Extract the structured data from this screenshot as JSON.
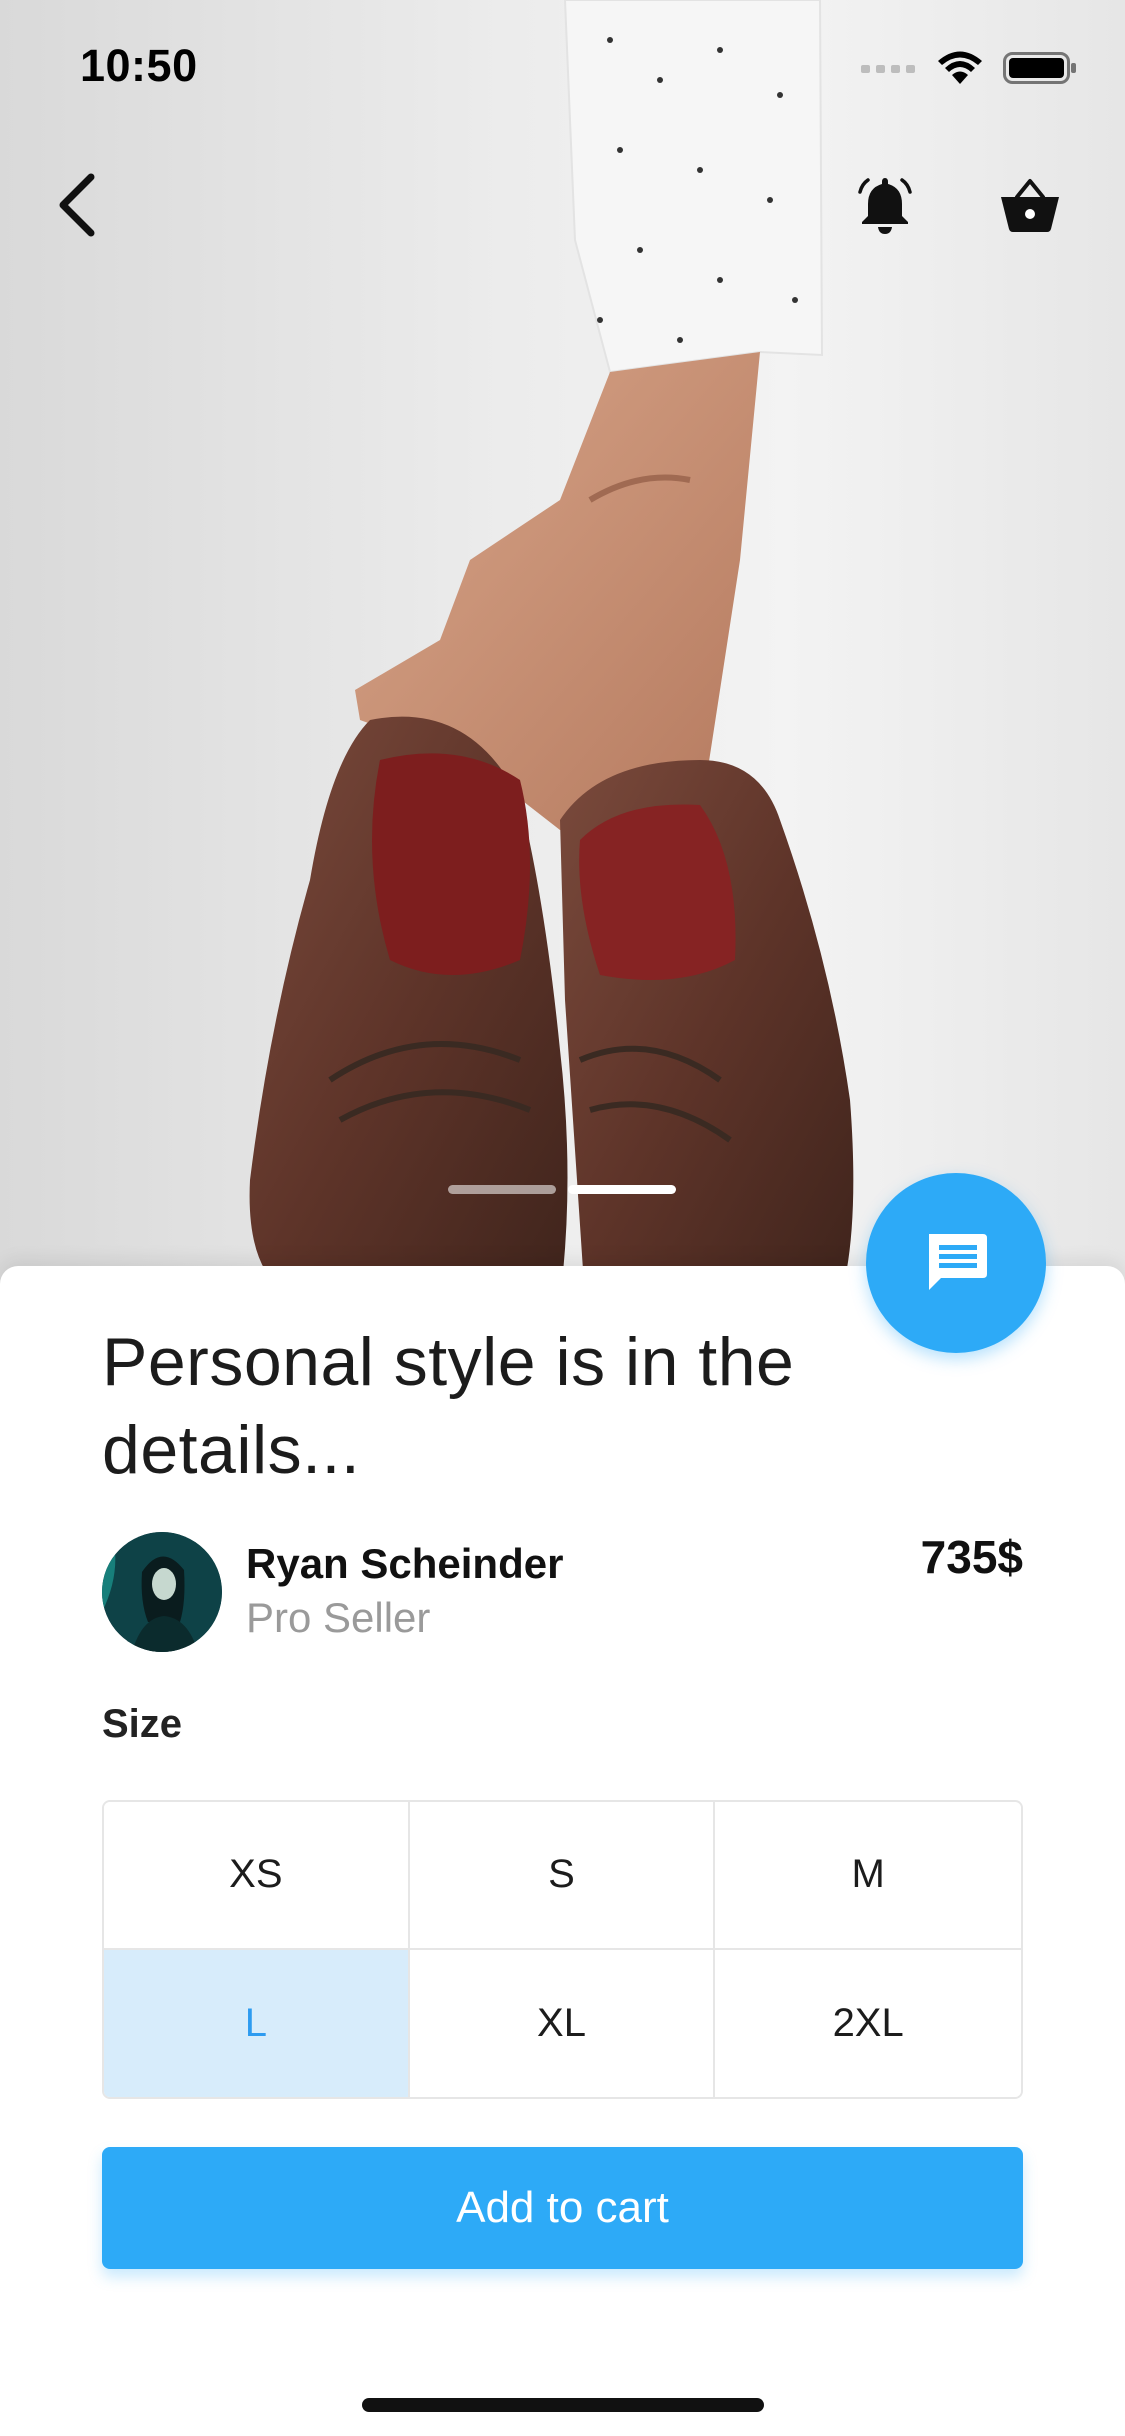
{
  "status_bar": {
    "time": "10:50"
  },
  "icons": {
    "back": "chevron-left-icon",
    "notifications": "bell-icon",
    "cart": "basket-icon",
    "chat": "chat-icon"
  },
  "carousel": {
    "count": 2,
    "active_index": 1
  },
  "product": {
    "title": "Personal style is in the details...",
    "price": "735$"
  },
  "seller": {
    "name": "Ryan Scheinder",
    "role": "Pro Seller"
  },
  "sizes": {
    "label": "Size",
    "options": [
      "XS",
      "S",
      "M",
      "L",
      "XL",
      "2XL"
    ],
    "selected": "L"
  },
  "actions": {
    "add_to_cart": "Add to cart"
  },
  "colors": {
    "accent": "#2daaf7",
    "selected_bg": "#d7ecfb",
    "selected_text": "#2d9bf0"
  }
}
